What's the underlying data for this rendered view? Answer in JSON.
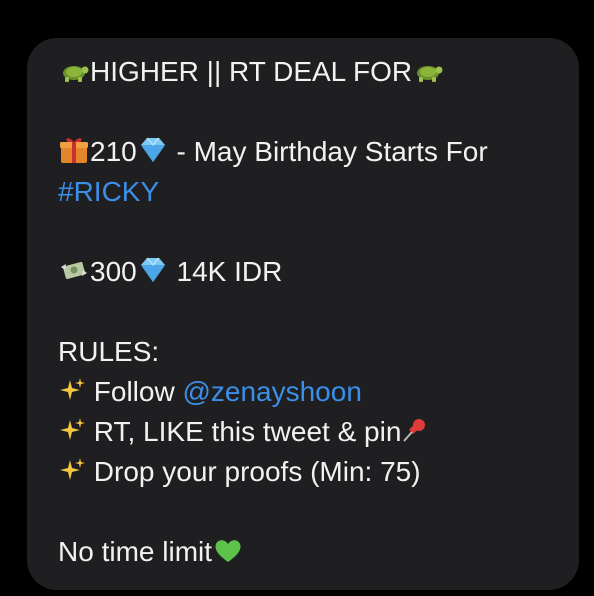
{
  "message": {
    "title": "HIGHER || RT DEAL FOR",
    "deal1_amount": "210",
    "deal1_desc": " - May Birthday Starts For",
    "deal1_hashtag": "#RICKY",
    "deal2_amount": "300",
    "deal2_price": " 14K IDR",
    "rules_heading": "RULES:",
    "rule1_text": " Follow ",
    "rule1_mention": "@zenayshoon",
    "rule2_text": " RT, LIKE this tweet & pin",
    "rule3_text": " Drop your proofs (Min: 75)",
    "footer": "No time limit"
  },
  "icons": {
    "title_icon": "turtle-icon",
    "gift": "gift-icon",
    "diamond": "gem-icon",
    "money": "money-wings-icon",
    "sparkles": "sparkles-icon",
    "pin": "pushpin-icon",
    "heart": "green-heart-icon"
  },
  "colors": {
    "bubble": "#1f1f21",
    "text": "#f2f2f2",
    "link": "#3b8fe8"
  }
}
